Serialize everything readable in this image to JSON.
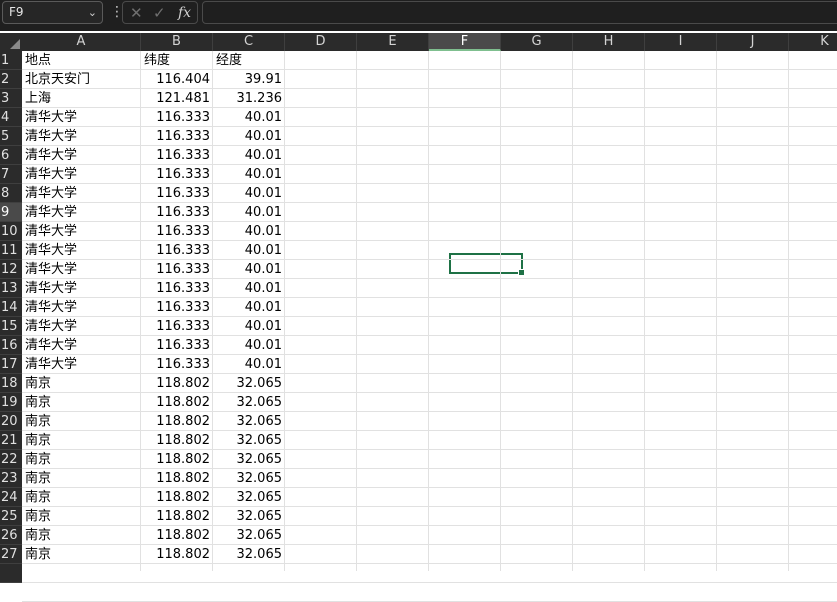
{
  "formula_bar": {
    "name_box": "F9",
    "formula": ""
  },
  "columns": [
    "A",
    "B",
    "C",
    "D",
    "E",
    "F",
    "G",
    "H",
    "I",
    "J",
    "K"
  ],
  "selected_column": "F",
  "selected_row": 9,
  "rows": [
    {
      "n": "1",
      "a": "地点",
      "b": "纬度",
      "c": "经度"
    },
    {
      "n": "2",
      "a": "北京天安门",
      "b": "116.404",
      "c": "39.91"
    },
    {
      "n": "3",
      "a": "上海",
      "b": "121.481",
      "c": "31.236"
    },
    {
      "n": "4",
      "a": "清华大学",
      "b": "116.333",
      "c": "40.01"
    },
    {
      "n": "5",
      "a": "清华大学",
      "b": "116.333",
      "c": "40.01"
    },
    {
      "n": "6",
      "a": "清华大学",
      "b": "116.333",
      "c": "40.01"
    },
    {
      "n": "7",
      "a": "清华大学",
      "b": "116.333",
      "c": "40.01"
    },
    {
      "n": "8",
      "a": "清华大学",
      "b": "116.333",
      "c": "40.01"
    },
    {
      "n": "9",
      "a": "清华大学",
      "b": "116.333",
      "c": "40.01"
    },
    {
      "n": "10",
      "a": "清华大学",
      "b": "116.333",
      "c": "40.01"
    },
    {
      "n": "11",
      "a": "清华大学",
      "b": "116.333",
      "c": "40.01"
    },
    {
      "n": "12",
      "a": "清华大学",
      "b": "116.333",
      "c": "40.01"
    },
    {
      "n": "13",
      "a": "清华大学",
      "b": "116.333",
      "c": "40.01"
    },
    {
      "n": "14",
      "a": "清华大学",
      "b": "116.333",
      "c": "40.01"
    },
    {
      "n": "15",
      "a": "清华大学",
      "b": "116.333",
      "c": "40.01"
    },
    {
      "n": "16",
      "a": "清华大学",
      "b": "116.333",
      "c": "40.01"
    },
    {
      "n": "17",
      "a": "清华大学",
      "b": "116.333",
      "c": "40.01"
    },
    {
      "n": "18",
      "a": "南京",
      "b": "118.802",
      "c": "32.065"
    },
    {
      "n": "19",
      "a": "南京",
      "b": "118.802",
      "c": "32.065"
    },
    {
      "n": "20",
      "a": "南京",
      "b": "118.802",
      "c": "32.065"
    },
    {
      "n": "21",
      "a": "南京",
      "b": "118.802",
      "c": "32.065"
    },
    {
      "n": "22",
      "a": "南京",
      "b": "118.802",
      "c": "32.065"
    },
    {
      "n": "23",
      "a": "南京",
      "b": "118.802",
      "c": "32.065"
    },
    {
      "n": "24",
      "a": "南京",
      "b": "118.802",
      "c": "32.065"
    },
    {
      "n": "25",
      "a": "南京",
      "b": "118.802",
      "c": "32.065"
    },
    {
      "n": "26",
      "a": "南京",
      "b": "118.802",
      "c": "32.065"
    },
    {
      "n": "27",
      "a": "南京",
      "b": "118.802",
      "c": "32.065"
    }
  ]
}
